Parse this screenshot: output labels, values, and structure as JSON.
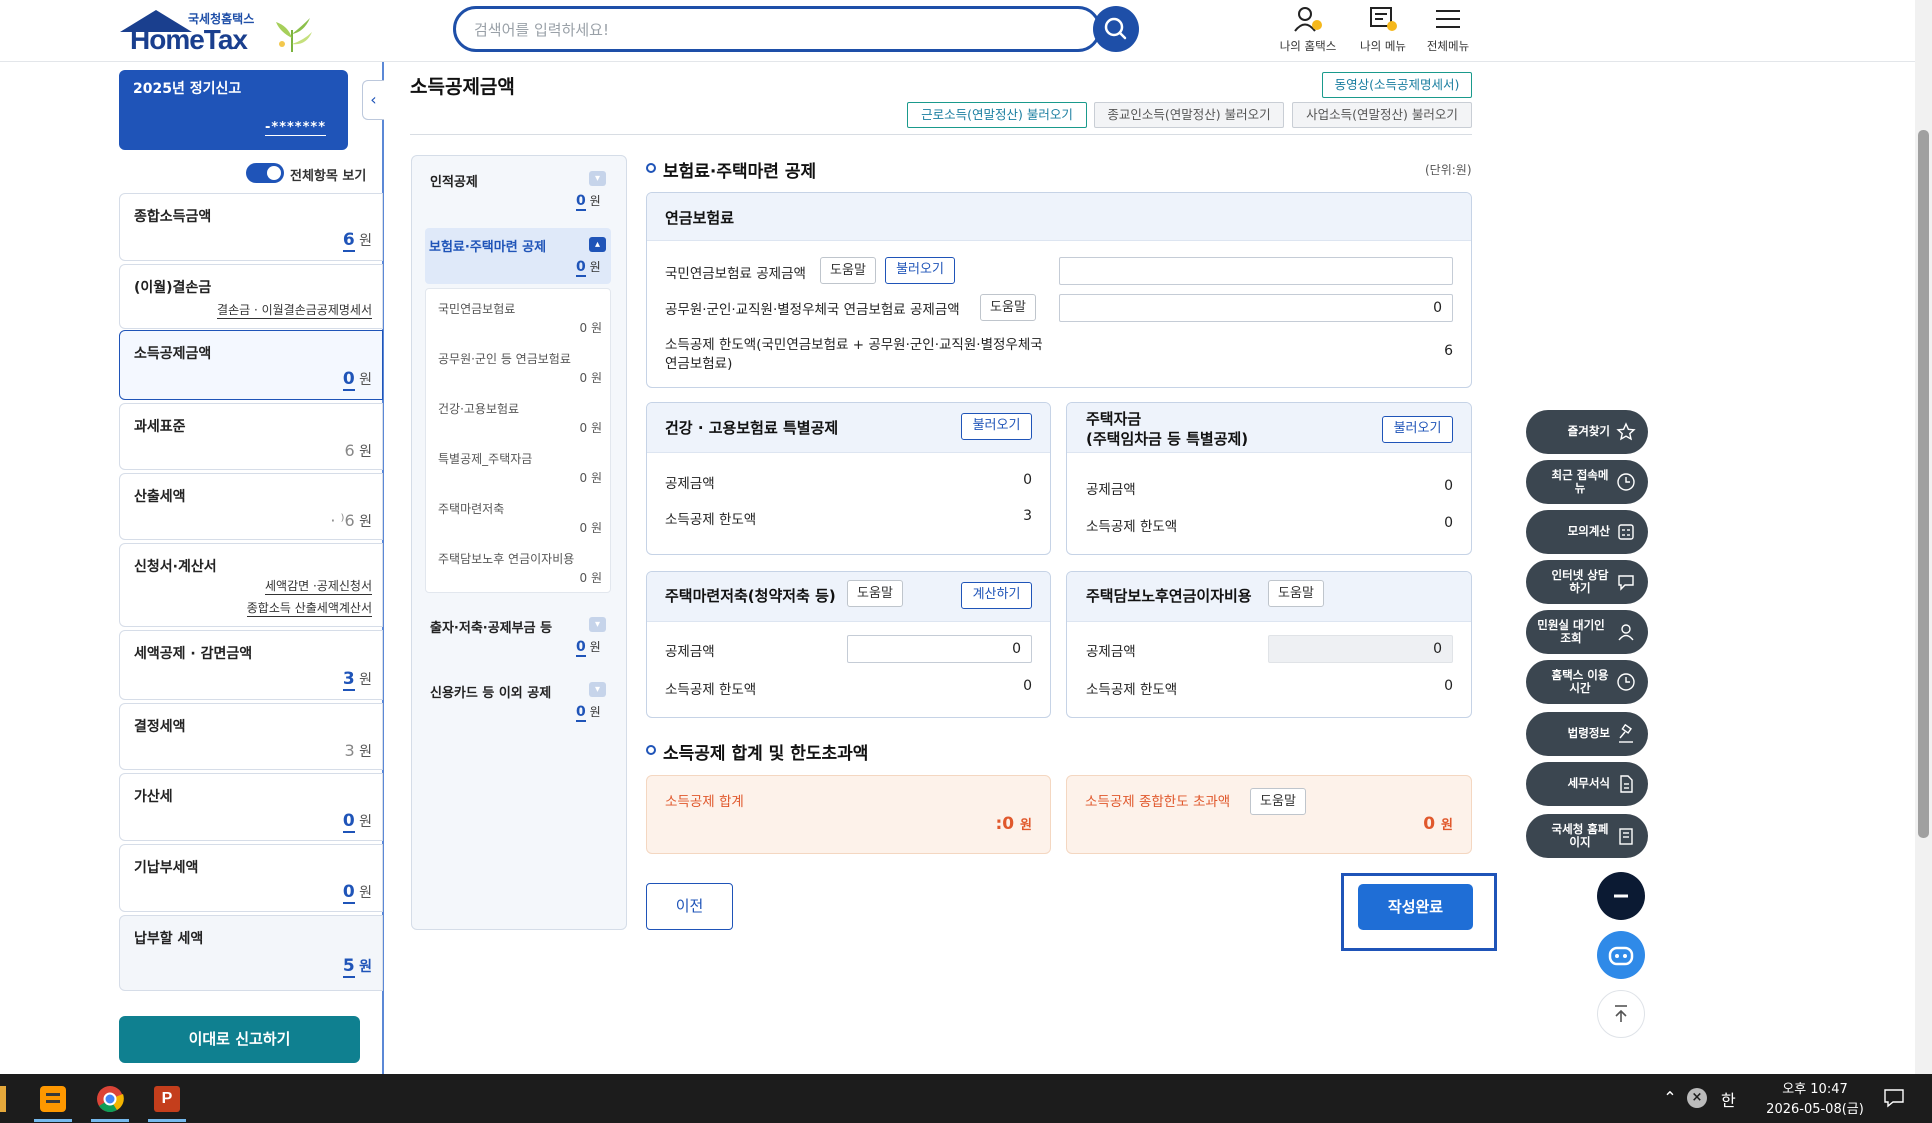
{
  "header": {
    "logo_small": "국세청홈택스",
    "logo_big": "HomeTax",
    "search_placeholder": "검색어를 입력하세요!",
    "nav": [
      "나의 홈택스",
      "나의 메뉴",
      "전체메뉴"
    ]
  },
  "sidebar": {
    "period_title": "2025년 정기신고",
    "masked_id": "-*******",
    "toggle_label": "전체항목 보기",
    "items": [
      {
        "label": "종합소득금액",
        "value": "6",
        "unit": "원"
      },
      {
        "label": "(이월)결손금",
        "link": "결손금 · 이월결손금공제명세서"
      },
      {
        "label": "소득공제금액",
        "value": "0",
        "unit": "원"
      },
      {
        "label": "과세표준",
        "value": "6",
        "unit": "원"
      },
      {
        "label": "산출세액",
        "value": "·  ⁾6",
        "unit": "원"
      },
      {
        "label": "신청서·계산서",
        "link1": "세액감면 ·공제신청서",
        "link2": "종합소득 산출세액계산서"
      },
      {
        "label": "세액공제 · 감면금액",
        "value": "3",
        "unit": "원"
      },
      {
        "label": "결정세액",
        "value": "3",
        "unit": "원"
      },
      {
        "label": "가산세",
        "value": "0",
        "unit": "원"
      },
      {
        "label": "기납부세액",
        "value": "0",
        "unit": "원"
      },
      {
        "label": "납부할 세액",
        "value": "5",
        "unit": "원"
      }
    ],
    "submit_label": "이대로 신고하기"
  },
  "main": {
    "page_title": "소득공제금액",
    "video_btn": "동영상(소득공제명세서)",
    "load_btns": [
      "근로소득(연말정산) 불러오기",
      "종교인소득(연말정산) 불러오기",
      "사업소득(연말정산) 불러오기"
    ],
    "subnav": {
      "groups": [
        {
          "label": "인적공제",
          "value": "0",
          "unit": "원"
        },
        {
          "label": "보험료·주택마련 공제",
          "value": "0",
          "unit": "원"
        },
        {
          "label": "출자·저축·공제부금 등",
          "value": "0",
          "unit": "원"
        },
        {
          "label": "신용카드 등 이외 공제",
          "value": "0",
          "unit": "원"
        }
      ],
      "subitems": [
        {
          "label": "국민연금보험료",
          "value": "0 원"
        },
        {
          "label": "공무원·군인 등 연금보험료",
          "value": "0 원"
        },
        {
          "label": "건강·고용보험료",
          "value": "0 원"
        },
        {
          "label": "특별공제_주택자금",
          "value": "0 원"
        },
        {
          "label": "주택마련저축",
          "value": "0 원"
        },
        {
          "label": "주택담보노후 연금이자비용",
          "value": "0 원"
        }
      ]
    },
    "section1": {
      "title": "보험료·주택마련 공제",
      "unit_note": "(단위:원)",
      "pension": {
        "title": "연금보험료",
        "row1_label": "국민연금보험료 공제금액",
        "row1_help": "도움말",
        "row1_load": "불러오기",
        "row1_value": "",
        "row2_label": "공무원·군인·교직원·별정우체국 연금보험료 공제금액",
        "row2_help": "도움말",
        "row2_value": "0",
        "row3_label_a": "소득공제 한도액(국민연금보험료 + 공무원·군인·교직원·별정우체국",
        "row3_label_b": "연금보험료)",
        "row3_value": "6"
      },
      "health": {
        "title": "건강 · 고용보험료 특별공제",
        "load": "불러오기",
        "amount_label": "공제금액",
        "amount_value": "0",
        "limit_label": "소득공제 한도액",
        "limit_value": "3"
      },
      "housing": {
        "title_a": "주택자금",
        "title_b": "(주택임차금 등 특별공제)",
        "load": "불러오기",
        "amount_label": "공제금액",
        "amount_value": "0",
        "limit_label": "소득공제 한도액",
        "limit_value": "0"
      },
      "savings": {
        "title": "주택마련저축(청약저축 등)",
        "help": "도움말",
        "calc": "계산하기",
        "amount_label": "공제금액",
        "amount_value": "0",
        "limit_label": "소득공제 한도액",
        "limit_value": "0"
      },
      "mortgage": {
        "title": "주택담보노후연금이자비용",
        "help": "도움말",
        "amount_label": "공제금액",
        "amount_value": "0",
        "limit_label": "소득공제 한도액",
        "limit_value": "0"
      }
    },
    "section2": {
      "title": "소득공제 합계 및 한도초과액",
      "total_label": "소득공제 합계",
      "total_value": ":0",
      "total_unit": "원",
      "excess_label": "소득공제 종합한도 초과액",
      "excess_help": "도움말",
      "excess_value": "0",
      "excess_unit": "원"
    },
    "prev_label": "이전",
    "done_label": "작성완료"
  },
  "quickmenu": [
    {
      "label": "즐겨찾기",
      "icon": "star-icon"
    },
    {
      "label": "최근 접속메뉴",
      "icon": "clock-icon"
    },
    {
      "label": "모의계산",
      "icon": "calculator-icon"
    },
    {
      "label": "인터넷 상담하기",
      "icon": "chat-icon"
    },
    {
      "label": "민원실 대기인 조회",
      "icon": "person-icon"
    },
    {
      "label": "홈택스 이용시간",
      "icon": "clock-icon"
    },
    {
      "label": "법령정보",
      "icon": "gavel-icon"
    },
    {
      "label": "세무서식",
      "icon": "document-icon"
    },
    {
      "label": "국세청 홈페이지",
      "icon": "building-icon"
    }
  ],
  "taskbar": {
    "time": "오후 10:47",
    "date": "2026-05-08(금)",
    "ime": "한"
  }
}
